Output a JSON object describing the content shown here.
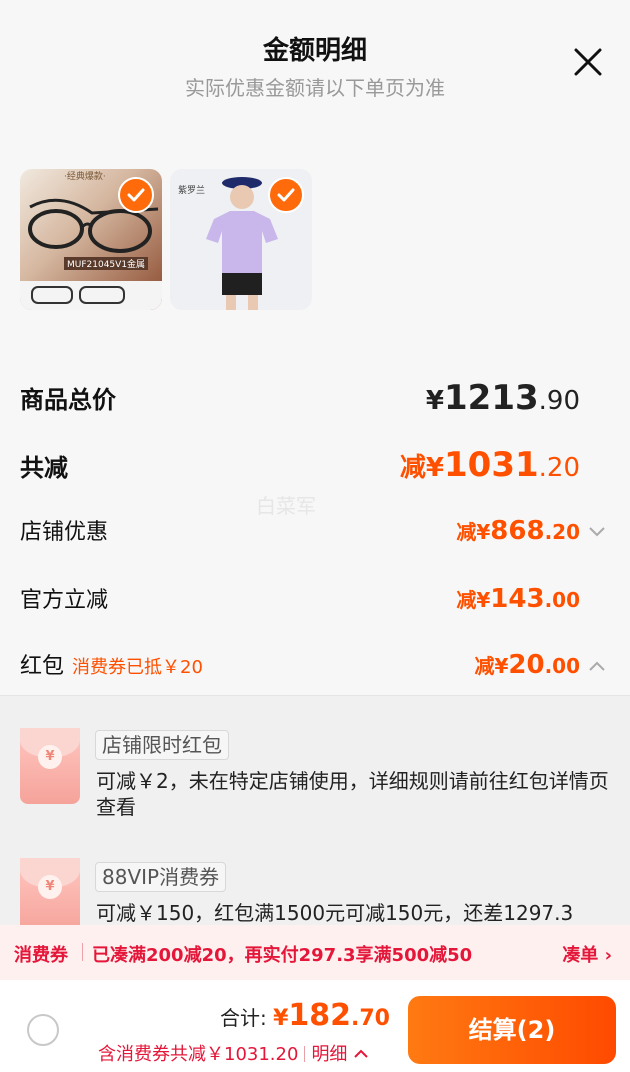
{
  "header": {
    "title": "金额明细",
    "subtitle": "实际优惠金额请以下单页为准",
    "close_icon": "close-icon"
  },
  "thumbnails": [
    {
      "caption_top": "·经典爆款·",
      "caption_mid": "MUF21045V1金属",
      "checked": true
    },
    {
      "caption_top": "紫罗兰",
      "checked": true
    }
  ],
  "summary": {
    "total_price": {
      "label": "商品总价",
      "currency": "¥",
      "integer": "1213",
      "decimal": ".90"
    },
    "total_reduce": {
      "label": "共减",
      "prefix": "减¥",
      "integer": "1031",
      "decimal": ".20"
    },
    "store_discount": {
      "label": "店铺优惠",
      "prefix": "减¥",
      "integer": "868",
      "decimal": ".20"
    },
    "official_reduce": {
      "label": "官方立减",
      "prefix": "减¥",
      "integer": "143",
      "decimal": ".00"
    },
    "red_packet": {
      "label": "红包",
      "note": "消费券已抵￥20",
      "prefix": "减¥",
      "integer": "20",
      "decimal": ".00"
    }
  },
  "watermark": "白菜军",
  "packets": [
    {
      "tag": "店铺限时红包",
      "desc": "可减￥2，未在特定店铺使用，详细规则请前往红包详情页查看"
    },
    {
      "tag": "88VIP消费券",
      "desc": "可减￥150，红包满1500元可减150元，还差1297.3"
    }
  ],
  "promo": {
    "label": "消费券",
    "message": "已凑满200减20，再实付297.3享满500减50",
    "action": "凑单 ›"
  },
  "bottom": {
    "total_label": "合计:",
    "currency": "¥",
    "total_integer": "182",
    "total_decimal": ".70",
    "sub_text": "含消费券共减￥1031.20",
    "detail_label": "明细",
    "checkout_label": "结算(2)"
  },
  "colors": {
    "accent": "#ff5000",
    "promo_red": "#e4173a"
  }
}
